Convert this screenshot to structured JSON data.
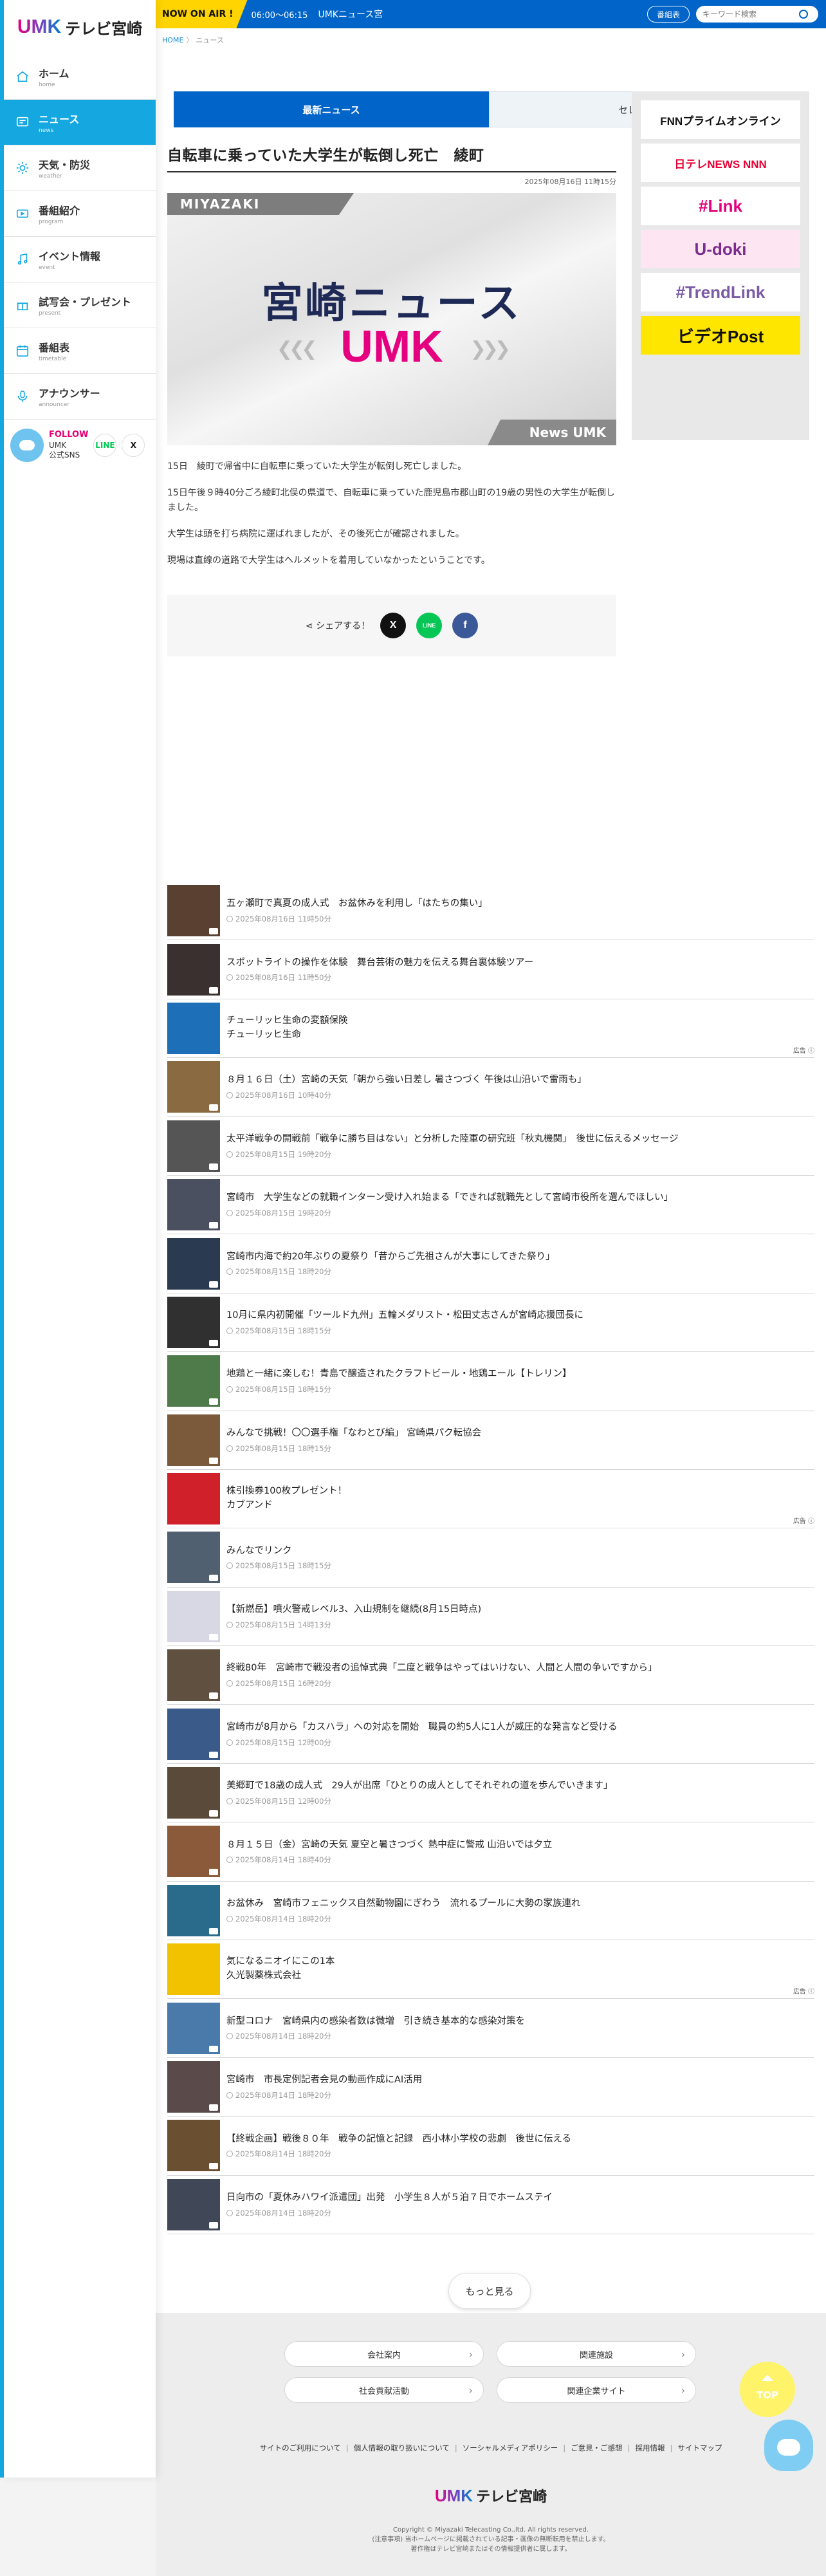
{
  "brand": {
    "logo_umk": "UMK",
    "logo_tv": "テレビ宮崎"
  },
  "sidebar": {
    "items": [
      {
        "label": "ホーム",
        "sub": "home",
        "icon": "home-icon"
      },
      {
        "label": "ニュース",
        "sub": "news",
        "icon": "news-icon",
        "active": true
      },
      {
        "label": "天気・防災",
        "sub": "weather",
        "icon": "sun-icon"
      },
      {
        "label": "番組紹介",
        "sub": "program",
        "icon": "tv-icon"
      },
      {
        "label": "イベント情報",
        "sub": "event",
        "icon": "music-icon"
      },
      {
        "label": "試写会・プレゼント",
        "sub": "present",
        "icon": "gift-icon"
      },
      {
        "label": "番組表",
        "sub": "timetable",
        "icon": "calendar-icon"
      },
      {
        "label": "アナウンサー",
        "sub": "announcer",
        "icon": "mic-icon"
      }
    ],
    "follow": {
      "label": "FOLLOW",
      "line1": "UMK",
      "line2": "公式SNS",
      "line": "LINE",
      "x": "X"
    }
  },
  "topbar": {
    "onair": "NOW ON AIR !",
    "time": "06:00〜06:15",
    "program": "UMKニュース宮",
    "timetable_button": "番組表",
    "search_placeholder": "キーワード検索"
  },
  "breadcrumb": {
    "home": "HOME",
    "sep": "〉",
    "current": "ニュース"
  },
  "tabs": {
    "latest": "最新ニュース",
    "select": "セレクション"
  },
  "article": {
    "title": "自転車に乗っていた大学生が転倒し死亡　綾町",
    "date": "2025年08月16日 11時15分",
    "image": {
      "tag_top": "MIYAZAKI",
      "headline": "宮崎ニュース",
      "logo": "UMK",
      "tag_bottom": "News UMK"
    },
    "paragraphs": [
      "15日　綾町で帰省中に自転車に乗っていた大学生が転倒し死亡しました。",
      "15日午後９時40分ごろ綾町北俣の県道で、自転車に乗っていた鹿児島市郡山町の19歳の男性の大学生が転倒しました。",
      "大学生は頭を打ち病院に運ばれましたが、その後死亡が確認されました。",
      "現場は直線の道路で大学生はヘルメットを着用していなかったということです。"
    ],
    "share_label": "シェアする！"
  },
  "banners": [
    {
      "name": "fnn-prime-online-banner",
      "text": "FNNプライムオンライン",
      "color": "#111",
      "bg": "#fff"
    },
    {
      "name": "nitele-news-nnn-banner",
      "text": "日テレNEWS NNN",
      "color": "#e60033",
      "bg": "#fff"
    },
    {
      "name": "link-banner",
      "text": "#Link",
      "color": "#e4007f",
      "bg": "#ffffff"
    },
    {
      "name": "u-doki-banner",
      "text": "U-doki",
      "color": "#7b2d8e",
      "bg": "#fde6f2"
    },
    {
      "name": "trend-link-banner",
      "text": "#TrendLink",
      "color": "#7b5aa6",
      "bg": "#fff"
    },
    {
      "name": "video-post-banner",
      "text": "ビデオPost",
      "color": "#111",
      "bg": "#ffe600"
    }
  ],
  "news": [
    {
      "title": "五ヶ瀬町で真夏の成人式　お盆休みを利用し「はたちの集い」",
      "date": "2025年08月16日 11時50分",
      "thumb": "#5a4030"
    },
    {
      "title": "スポットライトの操作を体験　舞台芸術の魅力を伝える舞台裏体験ツアー",
      "date": "2025年08月16日 11時50分",
      "thumb": "#3a3030"
    },
    {
      "title": "チューリッヒ生命の変額保険",
      "sub": "チューリッヒ生命",
      "ad": "広告",
      "thumb": "#1d6fb8"
    },
    {
      "title": "８月１６日（土）宮崎の天気「朝から強い日差し 暑さつづく 午後は山沿いで雷雨も」",
      "date": "2025年08月16日 10時40分",
      "thumb": "#8a6a40"
    },
    {
      "title": "太平洋戦争の開戦前「戦争に勝ち目はない」と分析した陸軍の研究班「秋丸機関」　後世に伝えるメッセージ",
      "date": "2025年08月15日 19時20分",
      "thumb": "#555"
    },
    {
      "title": "宮崎市　大学生などの就職インターン受け入れ始まる「できれば就職先として宮崎市役所を選んでほしい」",
      "date": "2025年08月15日 19時20分",
      "thumb": "#4a5060"
    },
    {
      "title": "宮崎市内海で約20年ぶりの夏祭り「昔からご先祖さんが大事にしてきた祭り」",
      "date": "2025年08月15日 18時20分",
      "thumb": "#2a3a50"
    },
    {
      "title": "10月に県内初開催「ツールド九州」五輪メダリスト・松田丈志さんが宮崎応援団長に",
      "date": "2025年08月15日 18時15分",
      "thumb": "#303030"
    },
    {
      "title": "地鶏と一緒に楽しむ！青島で醸造されたクラフトビール・地鶏エール【トレリン】",
      "date": "2025年08月15日 18時15分",
      "thumb": "#4f7a4a"
    },
    {
      "title": "みんなで挑戦！〇〇選手権「なわとび編」 宮崎県パク転協会",
      "date": "2025年08月15日 18時15分",
      "thumb": "#7a5a3a"
    },
    {
      "title": "株引換券100枚プレゼント！",
      "sub": "カブアンド",
      "ad": "広告",
      "thumb": "#d0202a"
    },
    {
      "title": "みんなでリンク",
      "date": "2025年08月15日 18時15分",
      "thumb": "#506070"
    },
    {
      "title": "【新燃岳】噴火警戒レベル3、入山規制を継続(8月15日時点)",
      "date": "2025年08月15日 14時13分",
      "thumb": "#d8d8e4"
    },
    {
      "title": "終戦80年　宮崎市で戦没者の追悼式典「二度と戦争はやってはいけない、人間と人間の争いですから」",
      "date": "2025年08月15日 16時20分",
      "thumb": "#605040"
    },
    {
      "title": "宮崎市が8月から「カスハラ」への対応を開始　職員の約5人に1人が威圧的な発言など受ける",
      "date": "2025年08月15日 12時00分",
      "thumb": "#3a5a8a"
    },
    {
      "title": "美郷町で18歳の成人式　29人が出席「ひとりの成人としてそれぞれの道を歩んでいきます」",
      "date": "2025年08月15日 12時00分",
      "thumb": "#5a4a3a"
    },
    {
      "title": "８月１５日（金）宮崎の天気 夏空と暑さつづく 熱中症に警戒 山沿いでは夕立",
      "date": "2025年08月14日 18時40分",
      "thumb": "#8a5a3a"
    },
    {
      "title": "お盆休み　宮崎市フェニックス自然動物園にぎわう　流れるプールに大勢の家族連れ",
      "date": "2025年08月14日 18時20分",
      "thumb": "#2a6a8a"
    },
    {
      "title": "気になるニオイにこの1本",
      "sub": "久光製薬株式会社",
      "ad": "広告",
      "thumb": "#f2c200"
    },
    {
      "title": "新型コロナ　宮崎県内の感染者数は微増　引き続き基本的な感染対策を",
      "date": "2025年08月14日 18時20分",
      "thumb": "#4a7aaa"
    },
    {
      "title": "宮崎市　市長定例記者会見の動画作成にAI活用",
      "date": "2025年08月14日 18時20分",
      "thumb": "#5a4a4a"
    },
    {
      "title": "【終戦企画】戦後８０年　戦争の記憶と記録　西小林小学校の悲劇　後世に伝える",
      "date": "2025年08月14日 18時20分",
      "thumb": "#6a5030"
    },
    {
      "title": "日向市の「夏休みハワイ派遣団」出発　小学生８人が５泊７日でホームステイ",
      "date": "2025年08月14日 18時20分",
      "thumb": "#404858"
    }
  ],
  "more_button": "もっと見る",
  "footer": {
    "buttons": [
      "会社案内",
      "関連施設",
      "社会貢献活動",
      "関連企業サイト"
    ],
    "links": [
      "サイトのご利用について",
      "個人情報の取り扱いについて",
      "ソーシャルメディアポリシー",
      "ご意見・ご感想",
      "採用情報",
      "サイトマップ"
    ],
    "copyright": "Copyright © Miyazaki Telecasting Co.,ltd. All rights reserved.",
    "note1": "(注意事項) 当ホームページに掲載されている記事・画像の無断転用を禁止します。",
    "note2": "著作権はテレビ宮崎またはその情報提供者に属します。",
    "to_top": "TOP"
  },
  "colors": {
    "accent": "#14a7e0",
    "brand_blue": "#0064c8",
    "onair_yellow": "#ffd400"
  }
}
